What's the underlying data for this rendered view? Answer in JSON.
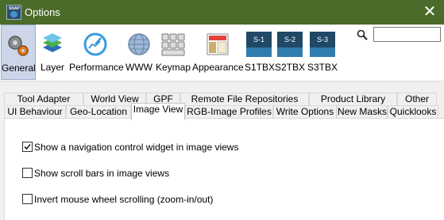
{
  "window": {
    "title": "Options",
    "close_glyph": "✕",
    "app_icon_text": "SNAP"
  },
  "toolbar": {
    "items": [
      {
        "label": "General",
        "icon": "gears-icon",
        "selected": true
      },
      {
        "label": "Layer",
        "icon": "layers-icon",
        "selected": false
      },
      {
        "label": "Performance",
        "icon": "gauge-icon",
        "selected": false
      },
      {
        "label": "WWW",
        "icon": "globe-icon",
        "selected": false
      },
      {
        "label": "Keymap",
        "icon": "keyboard-icon",
        "selected": false
      },
      {
        "label": "Appearance",
        "icon": "appearance-icon",
        "selected": false
      },
      {
        "label": "S1TBX",
        "icon": "s1-icon",
        "badge": "S-1",
        "selected": false
      },
      {
        "label": "S2TBX",
        "icon": "s2-icon",
        "badge": "S-2",
        "selected": false
      },
      {
        "label": "S3TBX",
        "icon": "s3-icon",
        "badge": "S-3",
        "selected": false
      }
    ],
    "search": {
      "icon": "search-icon",
      "value": "",
      "placeholder": ""
    }
  },
  "tabs": {
    "back_row": [
      "Tool Adapter",
      "World View",
      "GPF",
      "Remote File Repositories",
      "Product Library",
      "Other"
    ],
    "front_row": [
      "UI Behaviour",
      "Geo-Location",
      "Image View",
      "RGB-Image Profiles",
      "Write Options",
      "New Masks",
      "Quicklooks"
    ],
    "active": "Image View"
  },
  "options": [
    {
      "label": "Show a navigation control widget in image views",
      "checked": true
    },
    {
      "label": "Show scroll bars in image views",
      "checked": false
    },
    {
      "label": "Invert mouse wheel scrolling (zoom-in/out)",
      "checked": false
    }
  ],
  "colors": {
    "titlebar": "#4a6b2a",
    "selection": "#ccd6e8",
    "selection_border": "#99aed1"
  }
}
